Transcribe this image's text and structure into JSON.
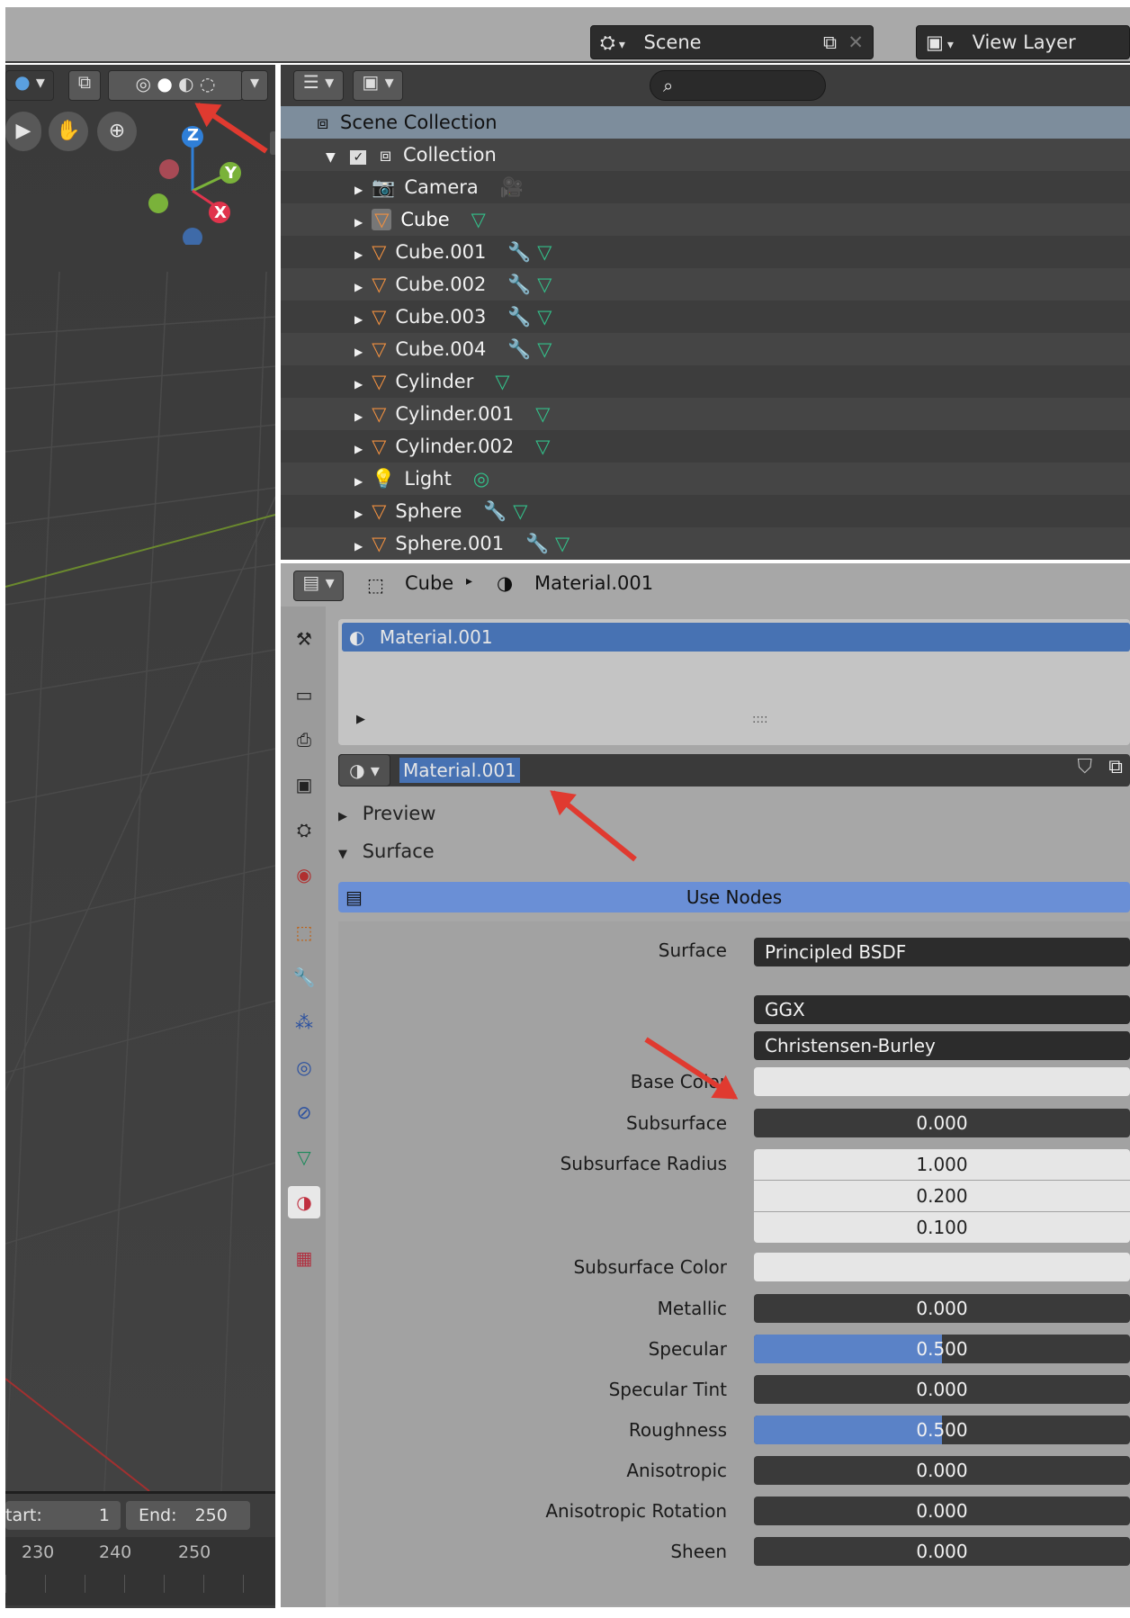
{
  "topbar": {
    "scene_label": "Scene",
    "view_layer_label": "View Layer"
  },
  "viewport": {
    "gizmo": {
      "z": "Z",
      "y": "Y",
      "x": "X"
    },
    "timeline": {
      "start_label": "tart:",
      "start_value": "1",
      "end_label": "End:",
      "end_value": "250",
      "ticks": [
        "230",
        "240",
        "250"
      ]
    }
  },
  "outliner": {
    "search_placeholder": "",
    "scene_collection": "Scene Collection",
    "collection": "Collection",
    "items": [
      {
        "name": "Camera",
        "type": "camera",
        "extra": "camera-data"
      },
      {
        "name": "Cube",
        "type": "mesh",
        "extra": "mesh-data",
        "selected": true
      },
      {
        "name": "Cube.001",
        "type": "mesh",
        "extra": "modifier+mesh"
      },
      {
        "name": "Cube.002",
        "type": "mesh",
        "extra": "modifier+mesh"
      },
      {
        "name": "Cube.003",
        "type": "mesh",
        "extra": "modifier+mesh"
      },
      {
        "name": "Cube.004",
        "type": "mesh",
        "extra": "modifier+mesh"
      },
      {
        "name": "Cylinder",
        "type": "mesh",
        "extra": "mesh-data"
      },
      {
        "name": "Cylinder.001",
        "type": "mesh",
        "extra": "mesh-data"
      },
      {
        "name": "Cylinder.002",
        "type": "mesh",
        "extra": "mesh-data"
      },
      {
        "name": "Light",
        "type": "light",
        "extra": "light-data"
      },
      {
        "name": "Sphere",
        "type": "mesh",
        "extra": "modifier+mesh"
      },
      {
        "name": "Sphere.001",
        "type": "mesh",
        "extra": "modifier+mesh"
      }
    ]
  },
  "properties": {
    "breadcrumb": {
      "object": "Cube",
      "material": "Material.001"
    },
    "slot": {
      "name": "Material.001",
      "grip": "::::"
    },
    "material_name": "Material.001",
    "sections": {
      "preview": "Preview",
      "surface": "Surface"
    },
    "use_nodes": "Use Nodes",
    "surface_label": "Surface",
    "surface_value": "Principled BSDF",
    "distribution": "GGX",
    "subsurface_method": "Christensen-Burley",
    "params": [
      {
        "label": "Base Color",
        "kind": "color",
        "value": ""
      },
      {
        "label": "Subsurface",
        "kind": "value",
        "value": "0.000",
        "fill": 0
      },
      {
        "label": "Subsurface Radius",
        "kind": "vector",
        "value": [
          "1.000",
          "0.200",
          "0.100"
        ]
      },
      {
        "label": "Subsurface Color",
        "kind": "color",
        "value": ""
      },
      {
        "label": "Metallic",
        "kind": "value",
        "value": "0.000",
        "fill": 0
      },
      {
        "label": "Specular",
        "kind": "value",
        "value": "0.500",
        "fill": 0.5
      },
      {
        "label": "Specular Tint",
        "kind": "value",
        "value": "0.000",
        "fill": 0
      },
      {
        "label": "Roughness",
        "kind": "value",
        "value": "0.500",
        "fill": 0.5
      },
      {
        "label": "Anisotropic",
        "kind": "value",
        "value": "0.000",
        "fill": 0
      },
      {
        "label": "Anisotropic Rotation",
        "kind": "value",
        "value": "0.000",
        "fill": 0
      },
      {
        "label": "Sheen",
        "kind": "value",
        "value": "0.000",
        "fill": 0
      }
    ]
  },
  "colors": {
    "selection": "#4772b3",
    "use_nodes": "#6a8fd6",
    "annotation": "#e03a30"
  }
}
